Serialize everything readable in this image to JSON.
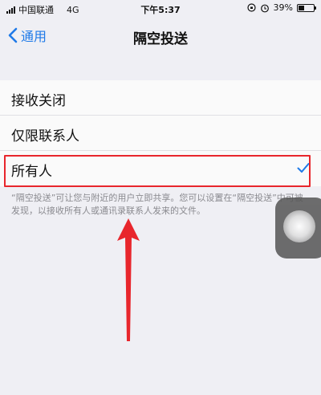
{
  "status_bar": {
    "carrier": "中国联通",
    "network": "4G",
    "time": "下午5:37",
    "battery": "39%",
    "battery_level": 0.39
  },
  "nav": {
    "back_label": "通用",
    "title": "隔空投送"
  },
  "options": [
    {
      "label": "接收关闭",
      "selected": false
    },
    {
      "label": "仅限联系人",
      "selected": false
    },
    {
      "label": "所有人",
      "selected": true
    }
  ],
  "footer_note": "“隔空投送”可让您与附近的用户立即共享。您可以设置在“隔空投送”中可被发现，以接收所有人或通讯录联系人发来的文件。",
  "colors": {
    "accent": "#1f7ae8",
    "annotation": "#e8262c"
  },
  "icons": [
    "signal-icon",
    "alarm-icon",
    "lock-rotation-icon",
    "battery-icon",
    "chevron-left-icon",
    "checkmark-icon"
  ]
}
